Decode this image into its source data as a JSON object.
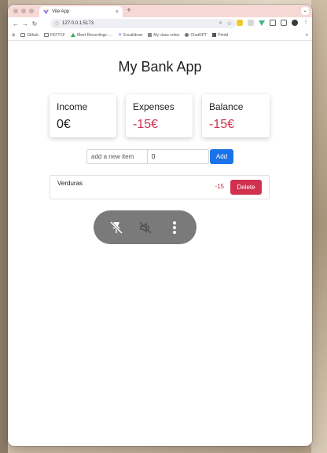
{
  "browser": {
    "tab_title": "Vite App",
    "tab_close": "×",
    "new_tab": "+",
    "url": "127.0.0.1:5173",
    "bookmarks": [
      "Github",
      "FEFTCF",
      "Meet Recordings -...",
      "Excalidraw",
      "My class notes",
      "ChatGPT",
      "Printd"
    ],
    "bookmarks_more": "»"
  },
  "app": {
    "title": "My Bank App",
    "summary": {
      "income": {
        "label": "Income",
        "value": "0€"
      },
      "expenses": {
        "label": "Expenses",
        "value": "-15€"
      },
      "balance": {
        "label": "Balance",
        "value": "-15€"
      }
    },
    "form": {
      "description_placeholder": "add a new item",
      "amount_value": "0",
      "add_label": "Add"
    },
    "transactions": [
      {
        "description": "Verduras",
        "amount": "-15",
        "delete_label": "Delete"
      }
    ]
  },
  "media_controls": {
    "icons": [
      "pin-off-icon",
      "mic-muted-icon",
      "more-vertical-icon"
    ]
  },
  "colors": {
    "accent": "#1a73e8",
    "negative": "#d0314f",
    "tab_bar": "#f6d9d4"
  }
}
